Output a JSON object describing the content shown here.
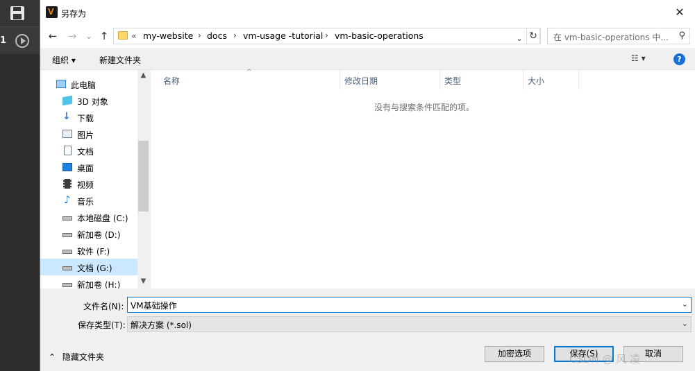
{
  "dialog": {
    "title": "另存为",
    "close_glyph": "✕"
  },
  "nav": {
    "back_glyph": "←",
    "forward_glyph": "→",
    "recent_glyph": "⌄",
    "up_glyph": "↑",
    "overflow": "«",
    "breadcrumbs": [
      "my-website",
      "docs",
      "vm-usage -tutorial",
      "vm-basic-operations"
    ],
    "separator": "›",
    "dropdown_glyph": "⌄",
    "refresh_glyph": "↻",
    "search_placeholder": "在 vm-basic-operations 中...",
    "search_glyph": "⚲"
  },
  "toolbar": {
    "organize_label": "组织 ▾",
    "new_folder_label": "新建文件夹",
    "view_glyph": "☷ ▾",
    "help_glyph": "?"
  },
  "navpane": {
    "items": [
      {
        "label": "此电脑",
        "icon": "computer-icon"
      },
      {
        "label": "3D 对象",
        "icon": "cube-icon"
      },
      {
        "label": "下载",
        "icon": "download-icon"
      },
      {
        "label": "图片",
        "icon": "pictures-icon"
      },
      {
        "label": "文档",
        "icon": "document-icon"
      },
      {
        "label": "桌面",
        "icon": "desktop-icon"
      },
      {
        "label": "视频",
        "icon": "video-icon"
      },
      {
        "label": "音乐",
        "icon": "music-icon"
      },
      {
        "label": "本地磁盘 (C:)",
        "icon": "system-drive-icon"
      },
      {
        "label": "新加卷 (D:)",
        "icon": "drive-icon"
      },
      {
        "label": "软件 (F:)",
        "icon": "drive-icon"
      },
      {
        "label": "文档 (G:)",
        "icon": "drive-icon",
        "selected": true
      },
      {
        "label": "新加卷 (H:)",
        "icon": "drive-icon"
      }
    ],
    "scroll_up": "▲",
    "scroll_down": "▼"
  },
  "filelist": {
    "columns": [
      "名称",
      "修改日期",
      "类型",
      "大小"
    ],
    "sort_glyph": "^",
    "empty_message": "没有与搜索条件匹配的项。"
  },
  "bottom": {
    "filename_label": "文件名(N):",
    "filename_value": "VM基础操作",
    "filetype_label": "保存类型(T):",
    "filetype_value": "解决方案 (*.sol)",
    "dropdown_glyph": "⌄",
    "hide_folders_label": "隐藏文件夹",
    "hide_folders_glyph": "⌃",
    "encrypt_button": "加密选项",
    "save_button": "保存(S)",
    "cancel_button": "取消",
    "watermark": "CSDN @ 风 凌"
  },
  "background": {
    "counter": "1"
  },
  "colors": {
    "accent": "#0078d7",
    "selection": "#cce8ff",
    "help": "#1a6fd6",
    "app_logo": "#f28c1e"
  }
}
